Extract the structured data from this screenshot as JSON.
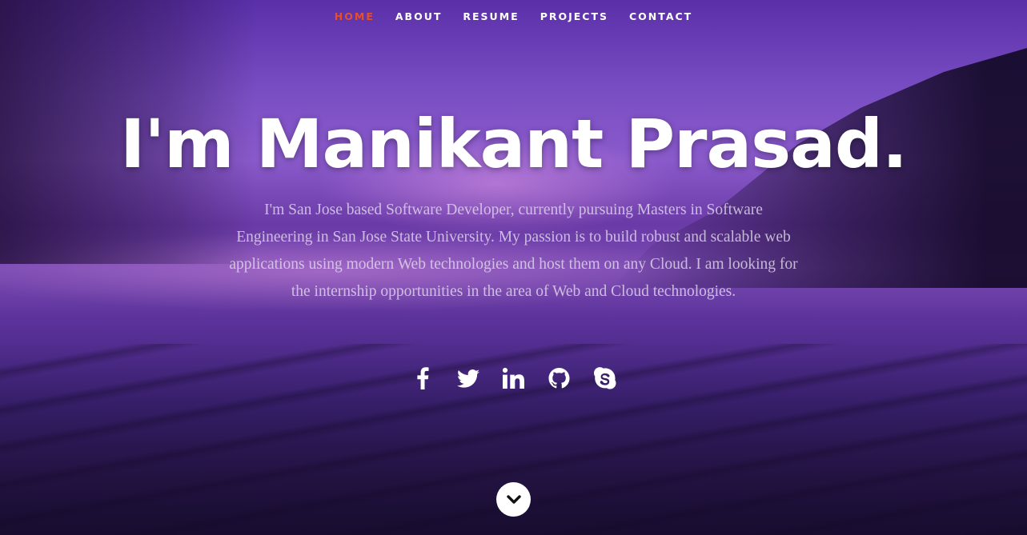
{
  "nav": {
    "items": [
      {
        "label": "HOME",
        "active": true
      },
      {
        "label": "ABOUT",
        "active": false
      },
      {
        "label": "RESUME",
        "active": false
      },
      {
        "label": "PROJECTS",
        "active": false
      },
      {
        "label": "CONTACT",
        "active": false
      }
    ],
    "active_color": "#e4502b"
  },
  "hero": {
    "headline": "I'm Manikant Prasad.",
    "bio": "I'm San Jose based Software Developer, currently pursuing Masters in Software Engineering in San Jose State University. My passion is to build robust and scalable web applications using modern Web technologies and host them on any Cloud. I am looking for the internship opportunities in the area of Web and Cloud technologies."
  },
  "social": [
    {
      "icon": "facebook-icon"
    },
    {
      "icon": "twitter-icon"
    },
    {
      "icon": "linkedin-icon"
    },
    {
      "icon": "github-icon"
    },
    {
      "icon": "skype-icon"
    }
  ],
  "scroll": {
    "icon": "chevron-down-icon"
  }
}
